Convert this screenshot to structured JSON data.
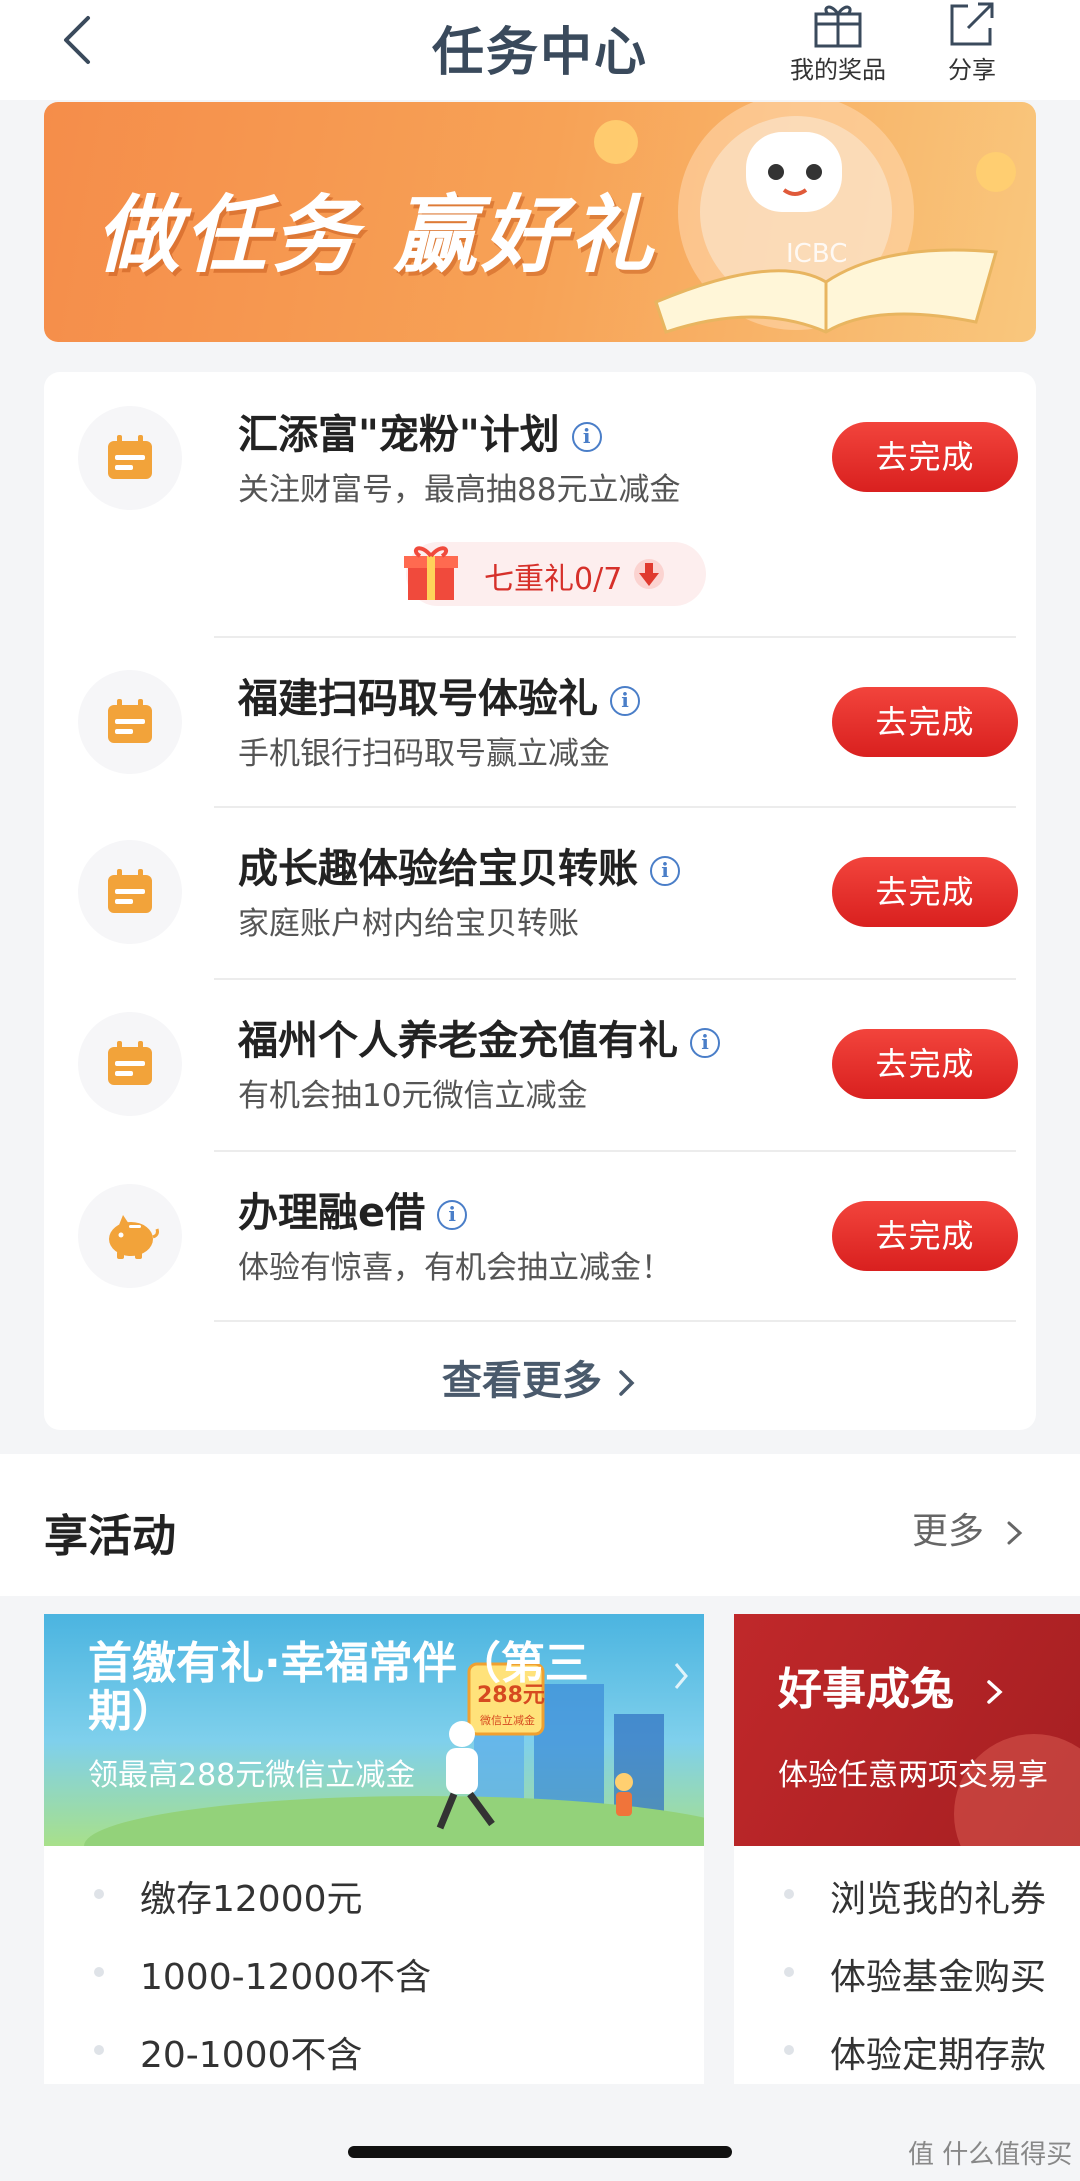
{
  "header": {
    "title": "任务中心",
    "my_prizes_label": "我的奖品",
    "share_label": "分享"
  },
  "banner": {
    "slogan": "做任务 赢好礼",
    "logo_text": "ICBC"
  },
  "tasks": [
    {
      "title": "汇添富\"宠粉\"计划",
      "subtitle": "关注财富号，最高抽88元立减金",
      "button": "去完成",
      "icon": "calendar-icon",
      "gift_badge": "七重礼0/7"
    },
    {
      "title": "福建扫码取号体验礼",
      "subtitle": "手机银行扫码取号赢立减金",
      "button": "去完成",
      "icon": "calendar-icon"
    },
    {
      "title": "成长趣体验给宝贝转账",
      "subtitle": "家庭账户树内给宝贝转账",
      "button": "去完成",
      "icon": "calendar-icon"
    },
    {
      "title": "福州个人养老金充值有礼",
      "subtitle": "有机会抽10元微信立减金",
      "button": "去完成",
      "icon": "calendar-icon"
    },
    {
      "title": "办理融e借",
      "subtitle": "体验有惊喜，有机会抽立减金！",
      "button": "去完成",
      "icon": "piggy-bank-icon"
    }
  ],
  "see_more": "查看更多",
  "activities": {
    "title": "享活动",
    "more": "更多",
    "cards": [
      {
        "name": "首缴有礼·幸福常伴（第三期）",
        "desc": "领最高288元微信立减金",
        "art_badge_amount": "288元",
        "art_badge_caption": "微信立减金",
        "items": [
          "缴存12000元",
          "1000-12000不含",
          "20-1000不含"
        ]
      },
      {
        "name": "好事成兔",
        "desc": "体验任意两项交易享",
        "items": [
          "浏览我的礼券",
          "体验基金购买",
          "体验定期存款"
        ]
      }
    ]
  },
  "watermark": "值 什么值得买",
  "colors": {
    "accent_red": "#e2302a",
    "title_gray": "#3a4a5c",
    "icon_orange": "#f0a030",
    "banner_orange": "#f58d4a"
  }
}
